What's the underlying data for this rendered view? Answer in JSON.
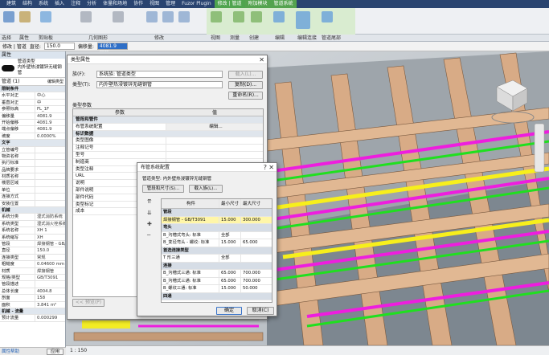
{
  "ribbon": {
    "tabs": [
      "建筑",
      "结构",
      "系统",
      "插入",
      "注释",
      "分析",
      "体量和场地",
      "协作",
      "视图",
      "管理",
      "Fuzor Plugin",
      "修改 | 管道",
      "附加模块",
      "管道系统"
    ],
    "panels": [
      "选择",
      "属性",
      "剪贴板",
      "几何图形",
      "修改",
      "视图",
      "测量",
      "创建",
      "编辑",
      "编辑连接",
      "管道尾部"
    ]
  },
  "options_bar": {
    "context": "修改 | 管道",
    "diameter_label": "直径:",
    "diameter_value": "150.0",
    "offset_label": "偏移量:",
    "offset_value": "4081.9 mm"
  },
  "properties": {
    "title": "属性",
    "type_name": "管道类型",
    "type_sub": "内外壁热浸镀锌无缝钢管",
    "filter": "管道 (1)",
    "edit_type": "编辑类型",
    "rows": [
      {
        "k": "限制条件",
        "v": "",
        "grp": true
      },
      {
        "k": "水平对正",
        "v": "中心"
      },
      {
        "k": "垂直对正",
        "v": "中"
      },
      {
        "k": "参照标高",
        "v": "FL_1F"
      },
      {
        "k": "偏移量",
        "v": "4081.9"
      },
      {
        "k": "开始偏移",
        "v": "4081.9"
      },
      {
        "k": "端点偏移",
        "v": "4081.9"
      },
      {
        "k": "坡度",
        "v": "0.0000%"
      },
      {
        "k": "文字",
        "v": "",
        "grp": true
      },
      {
        "k": "立管编号",
        "v": ""
      },
      {
        "k": "物资名称",
        "v": ""
      },
      {
        "k": "执行标准",
        "v": ""
      },
      {
        "k": "品牌要求",
        "v": ""
      },
      {
        "k": "材质名称",
        "v": ""
      },
      {
        "k": "楼层区域",
        "v": ""
      },
      {
        "k": "单位",
        "v": ""
      },
      {
        "k": "连接方式",
        "v": ""
      },
      {
        "k": "安装位置",
        "v": ""
      },
      {
        "k": "机械",
        "v": "",
        "grp": true
      },
      {
        "k": "系统分类",
        "v": "湿式消防系统"
      },
      {
        "k": "系统类型",
        "v": "湿式消火栓系统"
      },
      {
        "k": "系统名称",
        "v": "XH 1"
      },
      {
        "k": "系统缩写",
        "v": "XH"
      },
      {
        "k": "管段",
        "v": "焊接钢管 - GB/T3091"
      },
      {
        "k": "直径",
        "v": "150.0"
      },
      {
        "k": "连接类型",
        "v": "常规"
      },
      {
        "k": "粗糙度",
        "v": "0.04600 mm"
      },
      {
        "k": "材质",
        "v": "焊接钢管"
      },
      {
        "k": "规格/类型",
        "v": "GB/T3091"
      },
      {
        "k": "管段描述",
        "v": ""
      },
      {
        "k": "总体长度",
        "v": "4004.8"
      },
      {
        "k": "剖面",
        "v": "158"
      },
      {
        "k": "面积",
        "v": "3.841 m²"
      },
      {
        "k": "机械 - 流量",
        "v": "",
        "grp": true
      },
      {
        "k": "预计流量",
        "v": "0.000299"
      }
    ],
    "help_link": "属性帮助",
    "apply": "应用"
  },
  "type_dialog": {
    "title": "类型属性",
    "family_label": "族(F):",
    "family_value": "系统族: 管道类型",
    "type_label": "类型(T):",
    "type_value": "内外壁热浸镀锌无缝钢管",
    "load_btn": "载入(L)...",
    "duplicate_btn": "复制(D)...",
    "rename_btn": "重命名(R)...",
    "params_label": "类型参数",
    "col_param": "参数",
    "col_value": "值",
    "rows": [
      {
        "k": "管段和管件",
        "v": "",
        "grp": true
      },
      {
        "k": "布管系统配置",
        "v": "编辑..."
      },
      {
        "k": "标识数据",
        "v": "",
        "grp": true
      },
      {
        "k": "类型图像",
        "v": ""
      },
      {
        "k": "注释记号",
        "v": ""
      },
      {
        "k": "型号",
        "v": ""
      },
      {
        "k": "制造商",
        "v": ""
      },
      {
        "k": "类型注释",
        "v": ""
      },
      {
        "k": "URL",
        "v": ""
      },
      {
        "k": "说明",
        "v": ""
      },
      {
        "k": "部件说明",
        "v": ""
      },
      {
        "k": "部件代码",
        "v": ""
      },
      {
        "k": "类型标记",
        "v": ""
      },
      {
        "k": "成本",
        "v": ""
      }
    ],
    "preview_btn": "<< 预览(P)"
  },
  "routing_dialog": {
    "title": "布管系统配置",
    "close": "?",
    "pipe_type_label": "管道类型: 内外壁热浸镀锌无缝钢管",
    "segment_btn": "管段和尺寸(S)...",
    "load_btn": "载入族(L)...",
    "col_component": "构件",
    "col_min": "最小尺寸",
    "col_max": "最大尺寸",
    "rows": [
      {
        "c": "管段",
        "sec": true
      },
      {
        "c": "焊接钢管 - GB/T3091",
        "min": "15.000",
        "max": "300.000",
        "hl": true
      },
      {
        "c": "弯头",
        "sec": true
      },
      {
        "c": "B_沟槽式弯头: 标准",
        "min": "全部",
        "max": ""
      },
      {
        "c": "B_变径弯头 - 螺纹: 标准",
        "min": "15.000",
        "max": "65.000"
      },
      {
        "c": "首选连接类型",
        "sec": true
      },
      {
        "c": "T 形三通",
        "min": "全部",
        "max": ""
      },
      {
        "c": "连接",
        "sec": true
      },
      {
        "c": "B_沟槽式三通: 标准",
        "min": "65.000",
        "max": "700.000"
      },
      {
        "c": "B_沟槽式三通: 标准",
        "min": "65.000",
        "max": "700.000"
      },
      {
        "c": "B_螺纹三通: 标准",
        "min": "15.000",
        "max": "50.000"
      },
      {
        "c": "四通",
        "sec": true
      }
    ],
    "ok": "确定",
    "cancel": "取消(C)"
  },
  "status": {
    "scale": "1 : 150"
  },
  "colors": {
    "ribbon_bg": "#2a4470",
    "context_green": "#4fa44e",
    "pipe_magenta": "#ee1ddf",
    "pipe_green": "#1fe01f",
    "pipe_yellow": "#f7ef1c",
    "beam_wood": "#d8ab86"
  }
}
